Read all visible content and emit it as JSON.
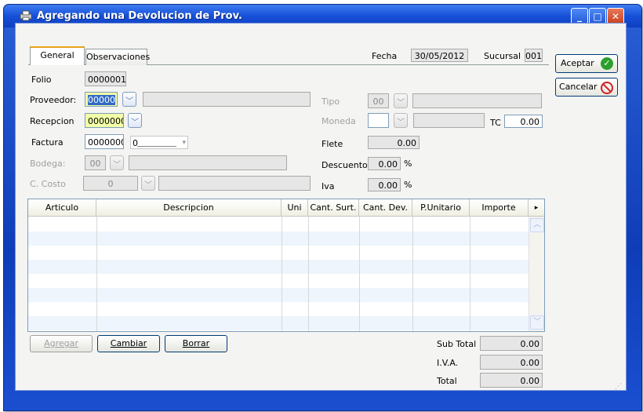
{
  "window": {
    "title": "Agregando una Devolucion de Prov.",
    "icon": "printer-app-icon",
    "controls": {
      "minimize": "_",
      "maximize": "□",
      "close": "✕"
    }
  },
  "tabs": [
    {
      "label": "General",
      "active": true
    },
    {
      "label": "Observaciones",
      "active": false
    }
  ],
  "header": {
    "fecha_label": "Fecha",
    "fecha_value": "30/05/2012",
    "sucursal_label": "Sucursal",
    "sucursal_value": "001"
  },
  "actions": {
    "aceptar": "Aceptar",
    "cancelar": "Cancelar"
  },
  "form": {
    "folio_label": "Folio",
    "folio_value": "0000001",
    "proveedor_label": "Proveedor:",
    "proveedor_value": "00000",
    "recepcion_label": "Recepcion",
    "recepcion_value": "0000000",
    "factura_label": "Factura",
    "factura_value": "0000000",
    "factura_combo_value": "0",
    "bodega_label": "Bodega:",
    "bodega_value": "00",
    "ccosto_label": "C. Costo",
    "ccosto_value": "0",
    "tipo_label": "Tipo",
    "tipo_value": "00",
    "moneda_label": "Moneda",
    "moneda_value": "",
    "tc_label": "TC",
    "tc_value": "0.00",
    "flete_label": "Flete",
    "flete_value": "0.00",
    "descuento_label": "Descuento",
    "descuento_value": "0.00",
    "descuento_unit": "%",
    "iva_label": "Iva",
    "iva_value": "0.00",
    "iva_unit": "%"
  },
  "grid": {
    "columns": [
      "Articulo",
      "Descripcion",
      "Uni",
      "Cant. Surt.",
      "Cant. Dev.",
      "P.Unitario",
      "Importe"
    ],
    "more_indicator": "▸",
    "scroll_up": "︿",
    "scroll_down": "﹀"
  },
  "row_buttons": {
    "agregar": "Agregar",
    "cambiar": "Cambiar",
    "borrar": "Borrar"
  },
  "totals": {
    "subtotal_label": "Sub Total",
    "subtotal_value": "0.00",
    "iva_label": "I.V.A.",
    "iva_value": "0.00",
    "total_label": "Total",
    "total_value": "0.00"
  },
  "colors": {
    "title_blue": "#1750d8",
    "required_yellow": "#f2ffa8",
    "accept_green": "#2ca02c",
    "cancel_red": "#d42020",
    "row_alt": "#eef5fc"
  }
}
